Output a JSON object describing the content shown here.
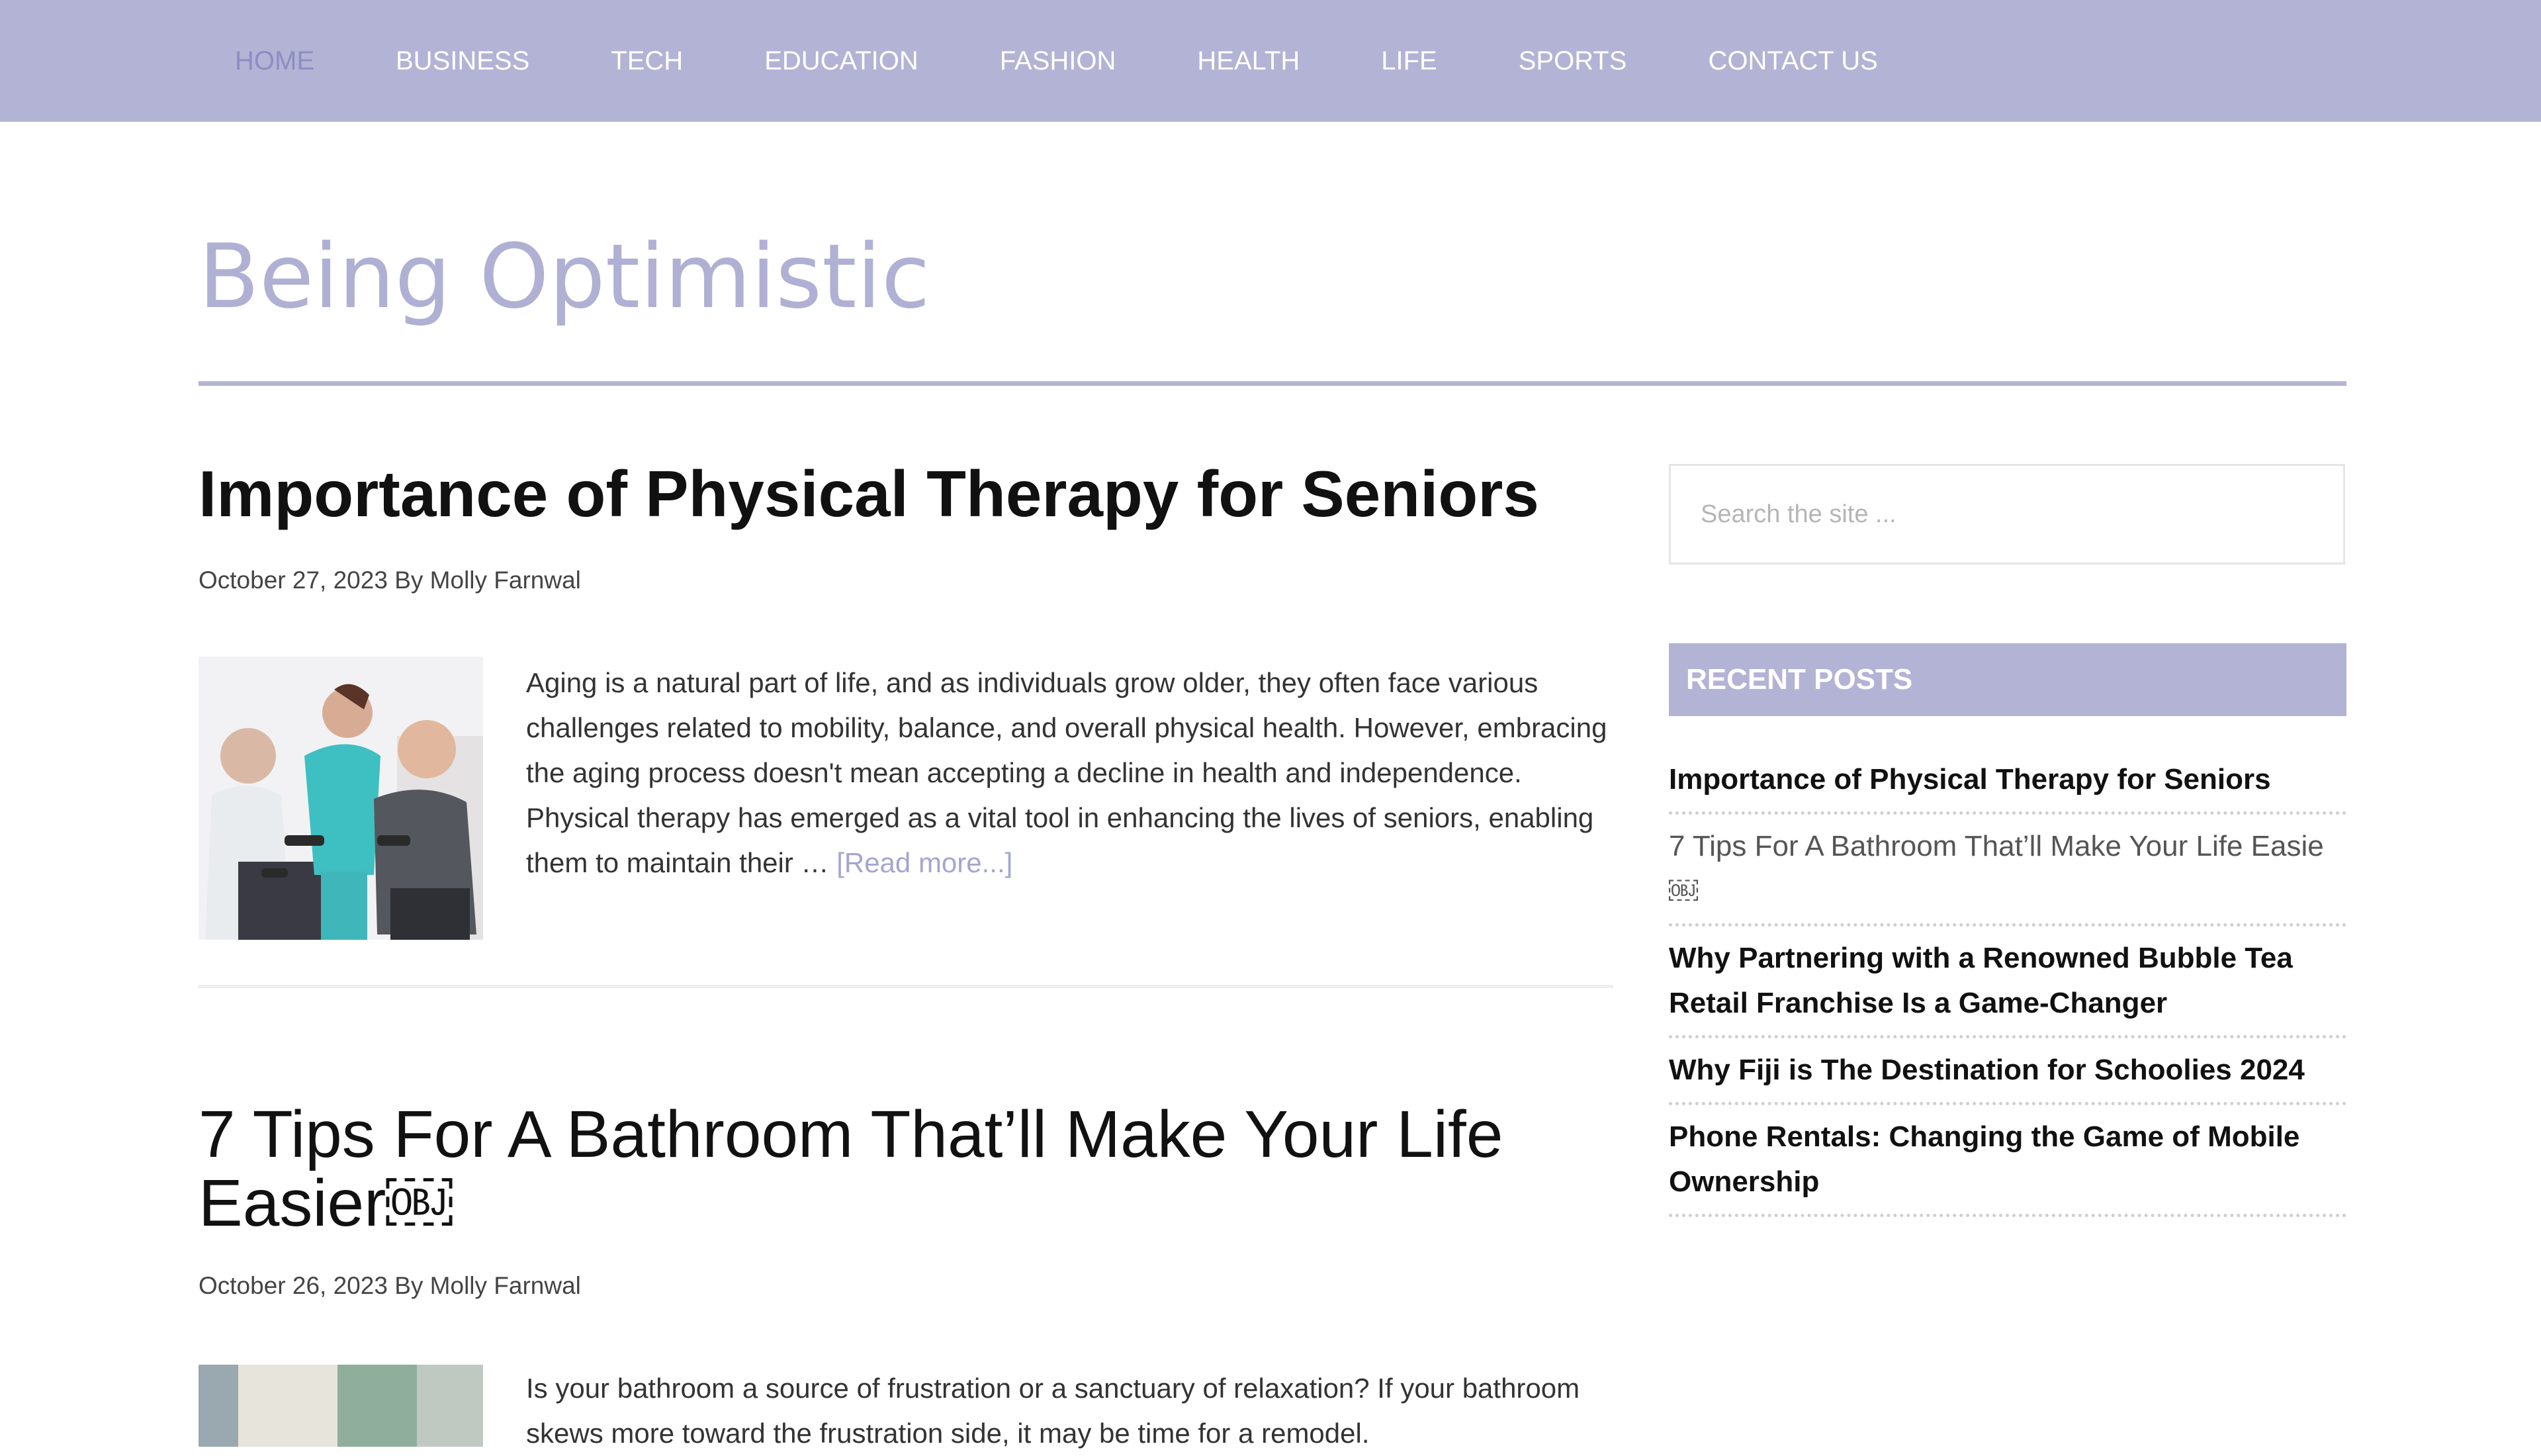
{
  "nav": {
    "items": [
      "HOME",
      "BUSINESS",
      "TECH",
      "EDUCATION",
      "FASHION",
      "HEALTH",
      "LIFE",
      "SPORTS",
      "CONTACT US"
    ],
    "active_index": 0
  },
  "page": {
    "title": "Being Optimistic"
  },
  "posts": [
    {
      "title": "Importance of Physical Therapy for Seniors",
      "date": "October 27, 2023",
      "by": "By",
      "author": "Molly Farnwal",
      "excerpt": "Aging is a natural part of life, and as individuals grow older, they often face various challenges related to mobility, balance, and overall physical health. However, embracing the aging process doesn't mean accepting a decline in health and independence. Physical therapy has emerged as a vital tool in enhancing the lives of seniors, enabling them to maintain their …",
      "read_more": "[Read more...]"
    },
    {
      "title": "7 Tips For A Bathroom That’ll Make Your Life Easier￼",
      "date": "October 26, 2023",
      "by": "By",
      "author": "Molly Farnwal",
      "excerpt": "Is your bathroom a source of frustration or a sanctuary of relaxation? If your bathroom skews more toward the frustration side, it may be time for a remodel."
    }
  ],
  "sidebar": {
    "search_placeholder": "Search the site ...",
    "widget_title": "RECENT POSTS",
    "recent_posts": [
      "Importance of Physical Therapy for Seniors",
      "7 Tips For A Bathroom That’ll Make Your Life Easie￼",
      "Why Partnering with a Renowned Bubble Tea Retail Franchise Is a Game-Changer",
      "Why Fiji is The Destination for Schoolies 2024",
      "Phone Rentals: Changing the Game of Mobile Ownership"
    ]
  },
  "colors": {
    "accent": "#b3b3d5",
    "title_light": "#b0b0d4",
    "nav_active": "#8d8dc4"
  }
}
